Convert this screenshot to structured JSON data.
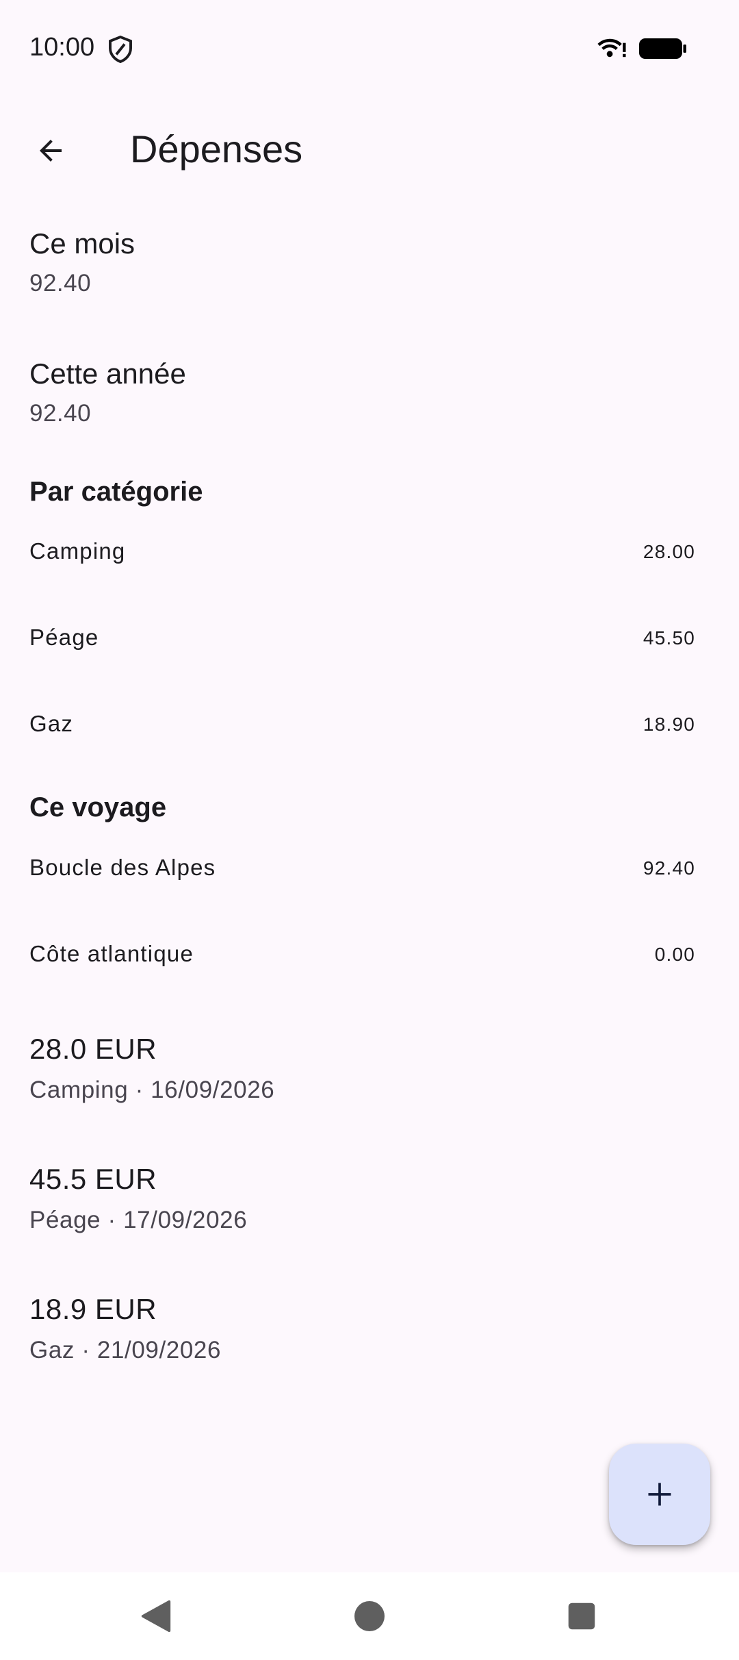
{
  "status_bar": {
    "time": "10:00",
    "icons": [
      "shield-icon",
      "wifi-icon",
      "battery-icon"
    ]
  },
  "app_bar": {
    "title": "Dépenses",
    "back_icon": "arrow-back-icon"
  },
  "summary": {
    "month": {
      "label": "Ce mois",
      "value": "92.40"
    },
    "year": {
      "label": "Cette année",
      "value": "92.40"
    }
  },
  "by_category": {
    "title": "Par catégorie",
    "items": [
      {
        "label": "Camping",
        "amount": "28.00"
      },
      {
        "label": "Péage",
        "amount": "45.50"
      },
      {
        "label": "Gaz",
        "amount": "18.90"
      }
    ]
  },
  "trips": {
    "title": "Ce voyage",
    "items": [
      {
        "label": "Boucle des Alpes",
        "amount": "92.40"
      },
      {
        "label": "Côte atlantique",
        "amount": "0.00"
      }
    ]
  },
  "expenses": [
    {
      "amount": "28.0 EUR",
      "meta": "Camping · 16/09/2026"
    },
    {
      "amount": "45.5 EUR",
      "meta": "Péage · 17/09/2026"
    },
    {
      "amount": "18.9 EUR",
      "meta": "Gaz · 21/09/2026"
    }
  ],
  "fab": {
    "icon": "plus-icon"
  },
  "nav_bar": {
    "buttons": [
      "back-triangle-icon",
      "home-circle-icon",
      "recents-square-icon"
    ]
  },
  "colors": {
    "background": "#fdf8fd",
    "fab_background": "#dce2fb",
    "text_primary": "#1c1b1f",
    "text_secondary": "#49454f"
  }
}
